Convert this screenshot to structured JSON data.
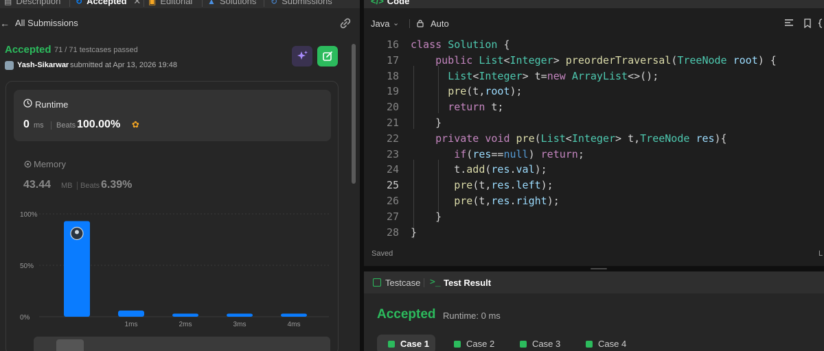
{
  "tabs": [
    {
      "label": "Description",
      "icon": "description-icon",
      "active": false
    },
    {
      "label": "Accepted",
      "icon": "history-icon",
      "active": true
    },
    {
      "label": "Editorial",
      "icon": "book-icon",
      "active": false
    },
    {
      "label": "Solutions",
      "icon": "flask-icon",
      "active": false
    },
    {
      "label": "Submissions",
      "icon": "history-icon",
      "active": false
    }
  ],
  "nav": {
    "back_label": "All Submissions"
  },
  "submission": {
    "status": "Accepted",
    "testcases": "71 / 71 testcases passed",
    "user": "Yash-Sikarwar",
    "submitted_at": "submitted at Apr 13, 2026 19:48"
  },
  "runtime": {
    "title": "Runtime",
    "value": "0",
    "unit": "ms",
    "beats_label": "Beats",
    "beats": "100.00%"
  },
  "memory": {
    "title": "Memory",
    "value": "43.44",
    "unit": "MB",
    "beats_label": "Beats",
    "beats": "6.39%"
  },
  "chart_data": {
    "type": "bar",
    "categories": [
      "",
      "1ms",
      "2ms",
      "3ms",
      "4ms"
    ],
    "values": [
      93,
      6,
      3,
      3,
      3
    ],
    "y_ticks": [
      "100%",
      "50%",
      "0%"
    ],
    "ylim": [
      0,
      100
    ],
    "highlight_index": 0,
    "bar_color": "#0a7cff"
  },
  "editor": {
    "title": "Code",
    "language": "Java",
    "mode": "Auto",
    "status": "Saved",
    "cursor": "L"
  },
  "code_lines": [
    {
      "n": "16",
      "t": "class Solution {"
    },
    {
      "n": "17",
      "t": "    public List<Integer> preorderTraversal(TreeNode root) {"
    },
    {
      "n": "18",
      "t": "      List<Integer> t=new ArrayList<>();"
    },
    {
      "n": "19",
      "t": "      pre(t,root);"
    },
    {
      "n": "20",
      "t": "      return t;"
    },
    {
      "n": "21",
      "t": "    }"
    },
    {
      "n": "22",
      "t": "    private void pre(List<Integer> t,TreeNode res){"
    },
    {
      "n": "23",
      "t": "       if(res==null) return;"
    },
    {
      "n": "24",
      "t": "       t.add(res.val);"
    },
    {
      "n": "25",
      "t": "       pre(t,res.left);"
    },
    {
      "n": "26",
      "t": "       pre(t,res.right);"
    },
    {
      "n": "27",
      "t": "    }"
    },
    {
      "n": "28",
      "t": "}"
    }
  ],
  "current_line": "25",
  "bottom": {
    "testcase_label": "Testcase",
    "result_label": "Test Result",
    "status": "Accepted",
    "runtime": "Runtime: 0 ms",
    "cases": [
      "Case 1",
      "Case 2",
      "Case 3",
      "Case 4"
    ]
  },
  "colors": {
    "accent_green": "#2cbb5d",
    "bar_blue": "#0a7cff",
    "ai_purple": "#a78bfa"
  }
}
